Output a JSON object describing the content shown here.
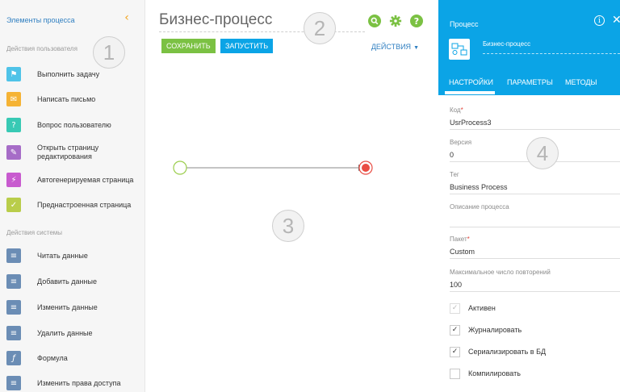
{
  "left_panel": {
    "header": "Элементы процесса",
    "user_actions_title": "Действия пользователя",
    "user_actions": [
      {
        "label": "Выполнить задачу",
        "icon": "flag-icon",
        "color": "#4fc3e8",
        "glyph": "⚑"
      },
      {
        "label": "Написать письмо",
        "icon": "envelope-icon",
        "color": "#f5b335",
        "glyph": "✉"
      },
      {
        "label": "Вопрос пользователю",
        "icon": "question-form-icon",
        "color": "#38c9b4",
        "glyph": "?"
      },
      {
        "label": "Открыть страницу редактирования",
        "icon": "edit-page-icon",
        "color": "#a66cc7",
        "glyph": "✎"
      },
      {
        "label": "Автогенерируемая страница",
        "icon": "auto-page-icon",
        "color": "#c85bcf",
        "glyph": "⚡"
      },
      {
        "label": "Преднастроенная страница",
        "icon": "preset-page-icon",
        "color": "#b9cd4a",
        "glyph": "✓"
      }
    ],
    "system_actions_title": "Действия системы",
    "system_actions": [
      {
        "label": "Читать данные",
        "icon": "read-data-icon",
        "color": "#6b8db5",
        "glyph": "≡"
      },
      {
        "label": "Добавить данные",
        "icon": "add-data-icon",
        "color": "#6b8db5",
        "glyph": "≡"
      },
      {
        "label": "Изменить данные",
        "icon": "edit-data-icon",
        "color": "#6b8db5",
        "glyph": "≡"
      },
      {
        "label": "Удалить данные",
        "icon": "delete-data-icon",
        "color": "#6b8db5",
        "glyph": "≡"
      },
      {
        "label": "Формула",
        "icon": "formula-icon",
        "color": "#6b8db5",
        "glyph": "ƒ"
      },
      {
        "label": "Изменить права доступа",
        "icon": "access-rights-icon",
        "color": "#6b8db5",
        "glyph": "≡"
      }
    ],
    "collapse_glyph": "‹"
  },
  "badges": [
    "1",
    "2",
    "3",
    "4"
  ],
  "center": {
    "title": "Бизнес-процесс",
    "save_label": "СОХРАНИТЬ",
    "run_label": "ЗАПУСТИТЬ",
    "actions_label": "ДЕЙСТВИЯ",
    "icons": {
      "search": {
        "color": "#7bc143",
        "glyph": "⚲"
      },
      "settings": {
        "color": "#7bc143",
        "glyph": "✱"
      },
      "help": {
        "color": "#7bc143",
        "glyph": "?"
      }
    },
    "diagram": {
      "start_color": "#9acd4a",
      "end_color": "#e94c43",
      "line_color": "#8a8a8a"
    }
  },
  "right_panel": {
    "title": "Процесс",
    "info_glyph": "i",
    "close_glyph": "✕",
    "process_name": "Бизнес-процесс",
    "tabs": [
      "НАСТРОЙКИ",
      "ПАРАМЕТРЫ",
      "МЕТОДЫ"
    ],
    "fields": {
      "code_label": "Код",
      "code_value": "UsrProcess3",
      "version_label": "Версия",
      "version_value": "0",
      "tag_label": "Тег",
      "tag_value": "Business Process",
      "description_label": "Описание процесса",
      "description_value": "",
      "package_label": "Пакет",
      "package_value": "Custom",
      "max_retries_label": "Максимальное число повторений",
      "max_retries_value": "100"
    },
    "checkboxes": [
      {
        "label": "Активен",
        "checked": true,
        "disabled": true
      },
      {
        "label": "Журналировать",
        "checked": true,
        "disabled": false
      },
      {
        "label": "Сериализировать в БД",
        "checked": true,
        "disabled": false
      },
      {
        "label": "Компилировать",
        "checked": false,
        "disabled": false
      }
    ],
    "accent_color": "#0ba4e6"
  }
}
